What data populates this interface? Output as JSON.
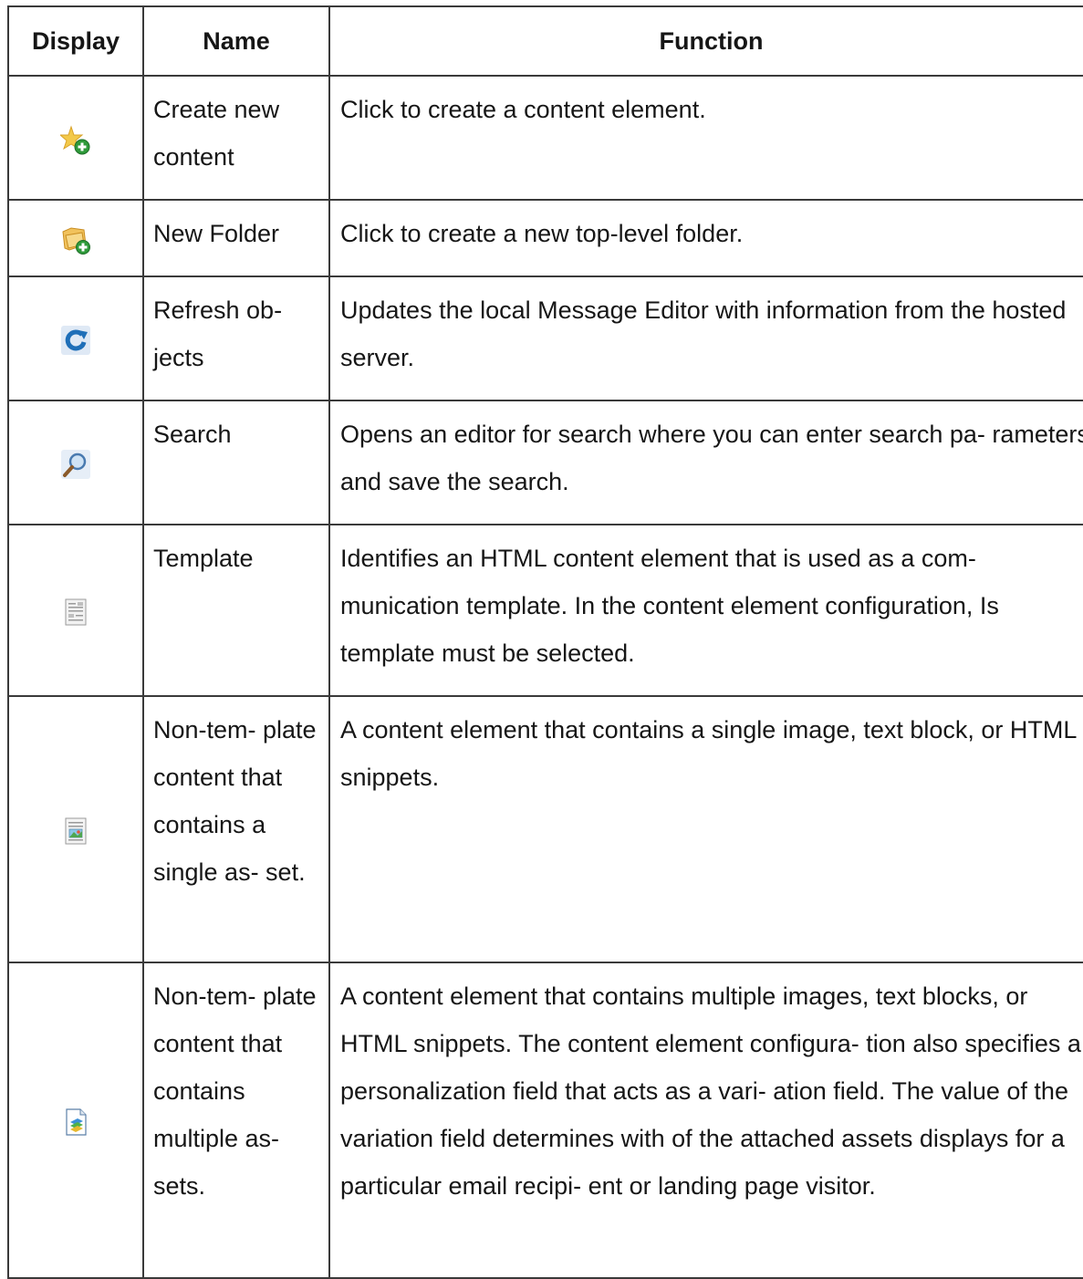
{
  "headers": {
    "display": "Display",
    "name": "Name",
    "function": "Function"
  },
  "rows": [
    {
      "icon": "create-content-icon",
      "name": "Create new content",
      "function": "Click to create a content element."
    },
    {
      "icon": "new-folder-icon",
      "name": "New Folder",
      "function": "Click to create a new top-level folder."
    },
    {
      "icon": "refresh-icon",
      "name": "Refresh ob- jects",
      "function": "Updates the local Message Editor with information from the hosted server."
    },
    {
      "icon": "search-icon",
      "name": "Search",
      "function": "Opens an editor for search where you can enter search pa- rameters and save the search."
    },
    {
      "icon": "template-icon",
      "name": "Template",
      "function": "Identifies an HTML content element that is used as a com- munication template. In the content element configuration, Is template must be selected."
    },
    {
      "icon": "single-asset-icon",
      "name": "Non-tem- plate content that contains a single as- set.",
      "function": "A content element that contains a single image, text block, or HTML snippets."
    },
    {
      "icon": "multiple-assets-icon",
      "name": "Non-tem- plate content that contains multiple as- sets.",
      "function": "A content element that contains multiple images, text blocks, or HTML snippets. The content element configura- tion also specifies a personalization field that acts as a vari- ation field. The value of the variation field determines with of the attached assets displays for a particular email recipi- ent or landing page visitor."
    }
  ]
}
